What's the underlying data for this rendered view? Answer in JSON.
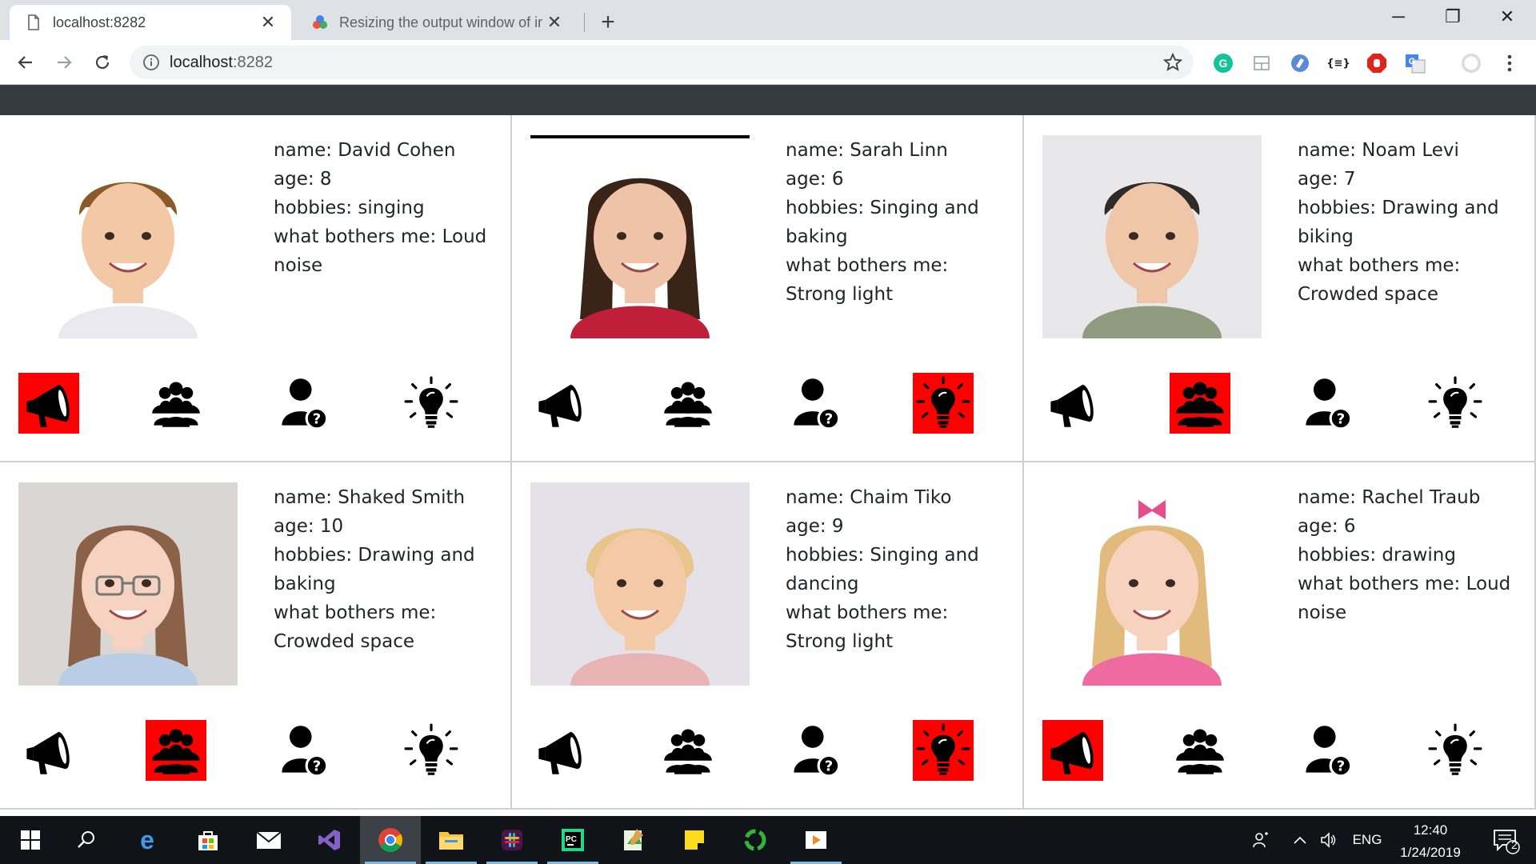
{
  "browser": {
    "tabs": [
      {
        "title": "localhost:8282",
        "active": true
      },
      {
        "title": "Resizing the output window of in",
        "active": false
      }
    ],
    "url": "localhost:8282",
    "url_host": "localhost",
    "url_port": ":8282",
    "new_tab": "+",
    "close": "✕",
    "window_controls": {
      "minimize": "─",
      "restore": "❐",
      "close": "✕"
    },
    "extensions": [
      "grammarly-icon",
      "layout-icon",
      "vpn-icon",
      "json-viewer-icon",
      "adblock-icon",
      "translate-icon",
      "profile-icon",
      "menu-icon"
    ],
    "json_ext_label": "{≡}"
  },
  "colors": {
    "highlight": "#ff0000",
    "topbar": "#343a40"
  },
  "children": [
    {
      "name": "name: David Cohen",
      "age": "age: 8",
      "hobbies": "hobbies: singing",
      "bothers": "what bothers me: Loud noise",
      "photo": "photo of boy with brown hair",
      "active": "noise"
    },
    {
      "name": "name: Sarah Linn",
      "age": "age: 6",
      "hobbies": "hobbies: Singing and baking",
      "bothers": "what bothers me: Strong light",
      "photo": "photo of girl with dark hair",
      "active": "light"
    },
    {
      "name": "name: Noam Levi",
      "age": "age: 7",
      "hobbies": "hobbies: Drawing and biking",
      "bothers": "what bothers me: Crowded space",
      "photo": "photo of boy with dark hair",
      "active": "crowd"
    },
    {
      "name": "name: Shaked Smith",
      "age": "age: 10",
      "hobbies": "hobbies: Drawing and baking",
      "bothers": "what bothers me: Crowded space",
      "photo": "photo of girl with glasses",
      "active": "crowd"
    },
    {
      "name": "name: Chaim Tiko",
      "age": "age: 9",
      "hobbies": "hobbies: Singing and dancing",
      "bothers": "what bothers me: Strong light",
      "photo": "photo of blond boy",
      "active": "light"
    },
    {
      "name": "name: Rachel Traub",
      "age": "age: 6",
      "hobbies": "hobbies: drawing",
      "bothers": "what bothers me: Loud noise",
      "photo": "photo of blond girl with bow",
      "active": "noise"
    }
  ],
  "icon_names": [
    "megaphone-icon",
    "group-icon",
    "user-question-icon",
    "lightbulb-icon"
  ],
  "taskbar": {
    "apps": [
      "start-icon",
      "search-icon",
      "edge-icon",
      "store-icon",
      "mail-icon",
      "visual-studio-icon",
      "chrome-icon",
      "file-explorer-icon",
      "slack-icon",
      "pycharm-icon",
      "notepad-icon",
      "sticky-notes-icon",
      "sync-icon",
      "media-player-icon"
    ],
    "language": "ENG",
    "time": "12:40",
    "date": "1/24/2019",
    "notifications": "2"
  }
}
